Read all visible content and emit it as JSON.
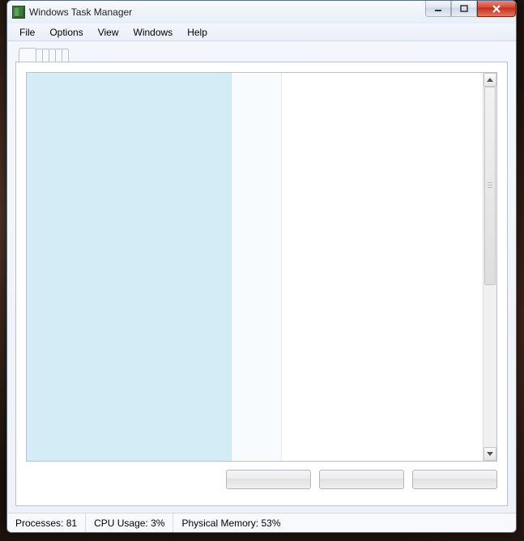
{
  "window": {
    "title": "Windows Task Manager"
  },
  "menu": {
    "items": [
      "File",
      "Options",
      "View",
      "Windows",
      "Help"
    ]
  },
  "status": {
    "processes_label": "Processes:",
    "processes_value": "81",
    "cpu_label": "CPU Usage:",
    "cpu_value": "3%",
    "memory_label": "Physical Memory:",
    "memory_value": "53%"
  }
}
